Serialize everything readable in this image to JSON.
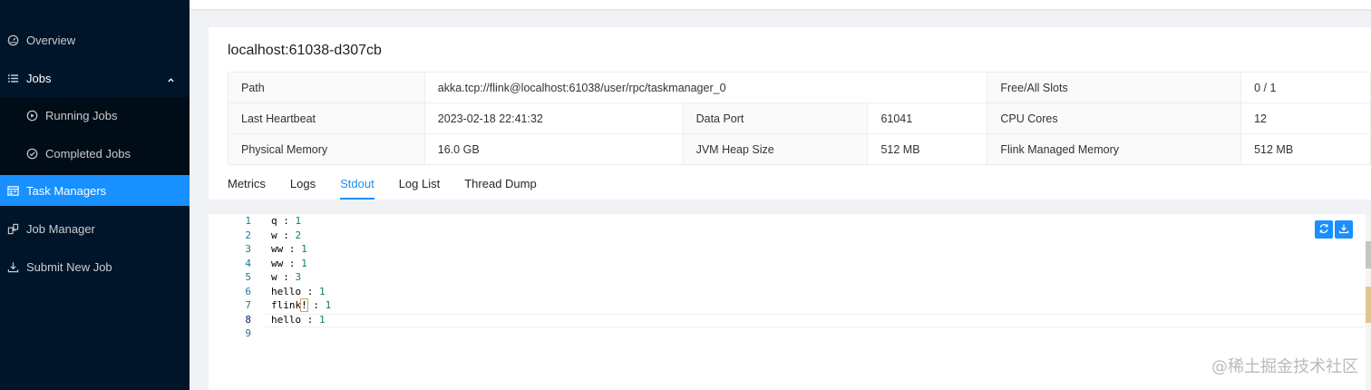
{
  "sidebar": {
    "items": [
      {
        "label": "Overview",
        "icon": "dashboard-icon"
      },
      {
        "label": "Jobs",
        "icon": "list-icon"
      },
      {
        "label": "Running Jobs",
        "icon": "play-circle-icon"
      },
      {
        "label": "Completed Jobs",
        "icon": "check-circle-icon"
      },
      {
        "label": "Task Managers",
        "icon": "schedule-icon"
      },
      {
        "label": "Job Manager",
        "icon": "cluster-icon"
      },
      {
        "label": "Submit New Job",
        "icon": "upload-icon"
      }
    ],
    "active": "Task Managers",
    "active_color": "#1890ff",
    "background": "#001529"
  },
  "card": {
    "title": "localhost:61038-d307cb",
    "rows": [
      {
        "path_label": "Path",
        "path_value": "akka.tcp://flink@localhost:61038/user/rpc/taskmanager_0",
        "slots_label": "Free/All Slots",
        "slots_value": "0 / 1"
      },
      {
        "heartbeat_label": "Last Heartbeat",
        "heartbeat_value": "2023-02-18 22:41:32",
        "port_label": "Data Port",
        "port_value": "61041",
        "cpu_label": "CPU Cores",
        "cpu_value": "12"
      },
      {
        "mem_label": "Physical Memory",
        "mem_value": "16.0 GB",
        "heap_label": "JVM Heap Size",
        "heap_value": "512 MB",
        "managed_label": "Flink Managed Memory",
        "managed_value": "512 MB"
      }
    ]
  },
  "tabs": [
    "Metrics",
    "Logs",
    "Stdout",
    "Log List",
    "Thread Dump"
  ],
  "active_tab": "Stdout",
  "editor": {
    "lines": [
      {
        "n": "1",
        "text": "q",
        "value": "1"
      },
      {
        "n": "2",
        "text": "w",
        "value": "2"
      },
      {
        "n": "3",
        "text": "ww",
        "value": "1"
      },
      {
        "n": "4",
        "text": "ww",
        "value": "1"
      },
      {
        "n": "5",
        "text": "w",
        "value": "3"
      },
      {
        "n": "6",
        "text": "hello",
        "value": "1"
      },
      {
        "n": "7",
        "text": "flink",
        "hl": "!",
        "value": "1"
      },
      {
        "n": "8",
        "text": "hello",
        "value": "1"
      },
      {
        "n": "9",
        "text": "",
        "value": ""
      }
    ],
    "current_line": "8",
    "buttons": [
      "reload-icon",
      "download-icon"
    ]
  },
  "watermark": "@稀土掘金技术社区"
}
